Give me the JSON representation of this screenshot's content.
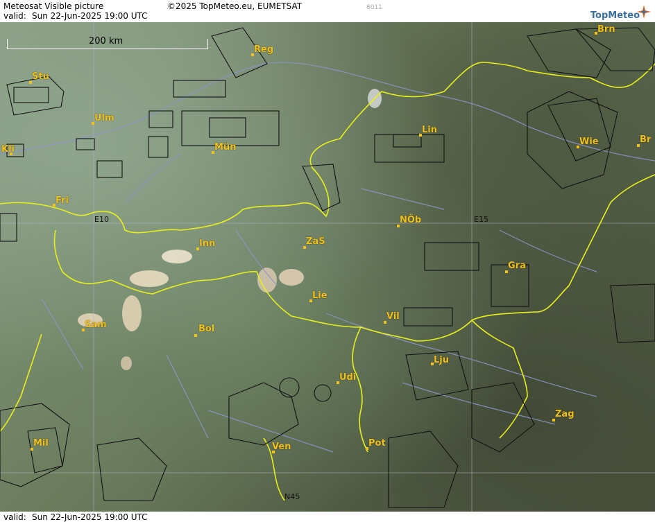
{
  "header": {
    "title": "Meteosat Visible picture",
    "copyright": "©2025 TopMeteo.eu, EUMETSAT",
    "code": "8011",
    "valid_label": "valid:",
    "valid_time": "Sun  22-Jun-2025  19:00 UTC",
    "logo_text": "TopMeteo"
  },
  "footer": {
    "valid_label": "valid:",
    "valid_time": "Sun  22-Jun-2025  19:00 UTC"
  },
  "scale": {
    "label": "200 km"
  },
  "grid_labels": {
    "lon_e10": "E10",
    "lon_e15": "E15",
    "lat_n45": "N45"
  },
  "cities": [
    "Reg",
    "Brn",
    "Stu",
    "Ulm",
    "Mün",
    "Lin",
    "Wie",
    "Br",
    "Kli",
    "Fri",
    "NÖb",
    "Inn",
    "ZaS",
    "Gra",
    "Lie",
    "Vil",
    "Sam",
    "Bol",
    "Lju",
    "Udi",
    "Zag",
    "Mil",
    "Ven",
    "Pot"
  ],
  "colors": {
    "city_label": "#f2c11a",
    "border_line": "#e8f01c",
    "river_line": "#8c95c8",
    "zone_line": "#111111"
  }
}
